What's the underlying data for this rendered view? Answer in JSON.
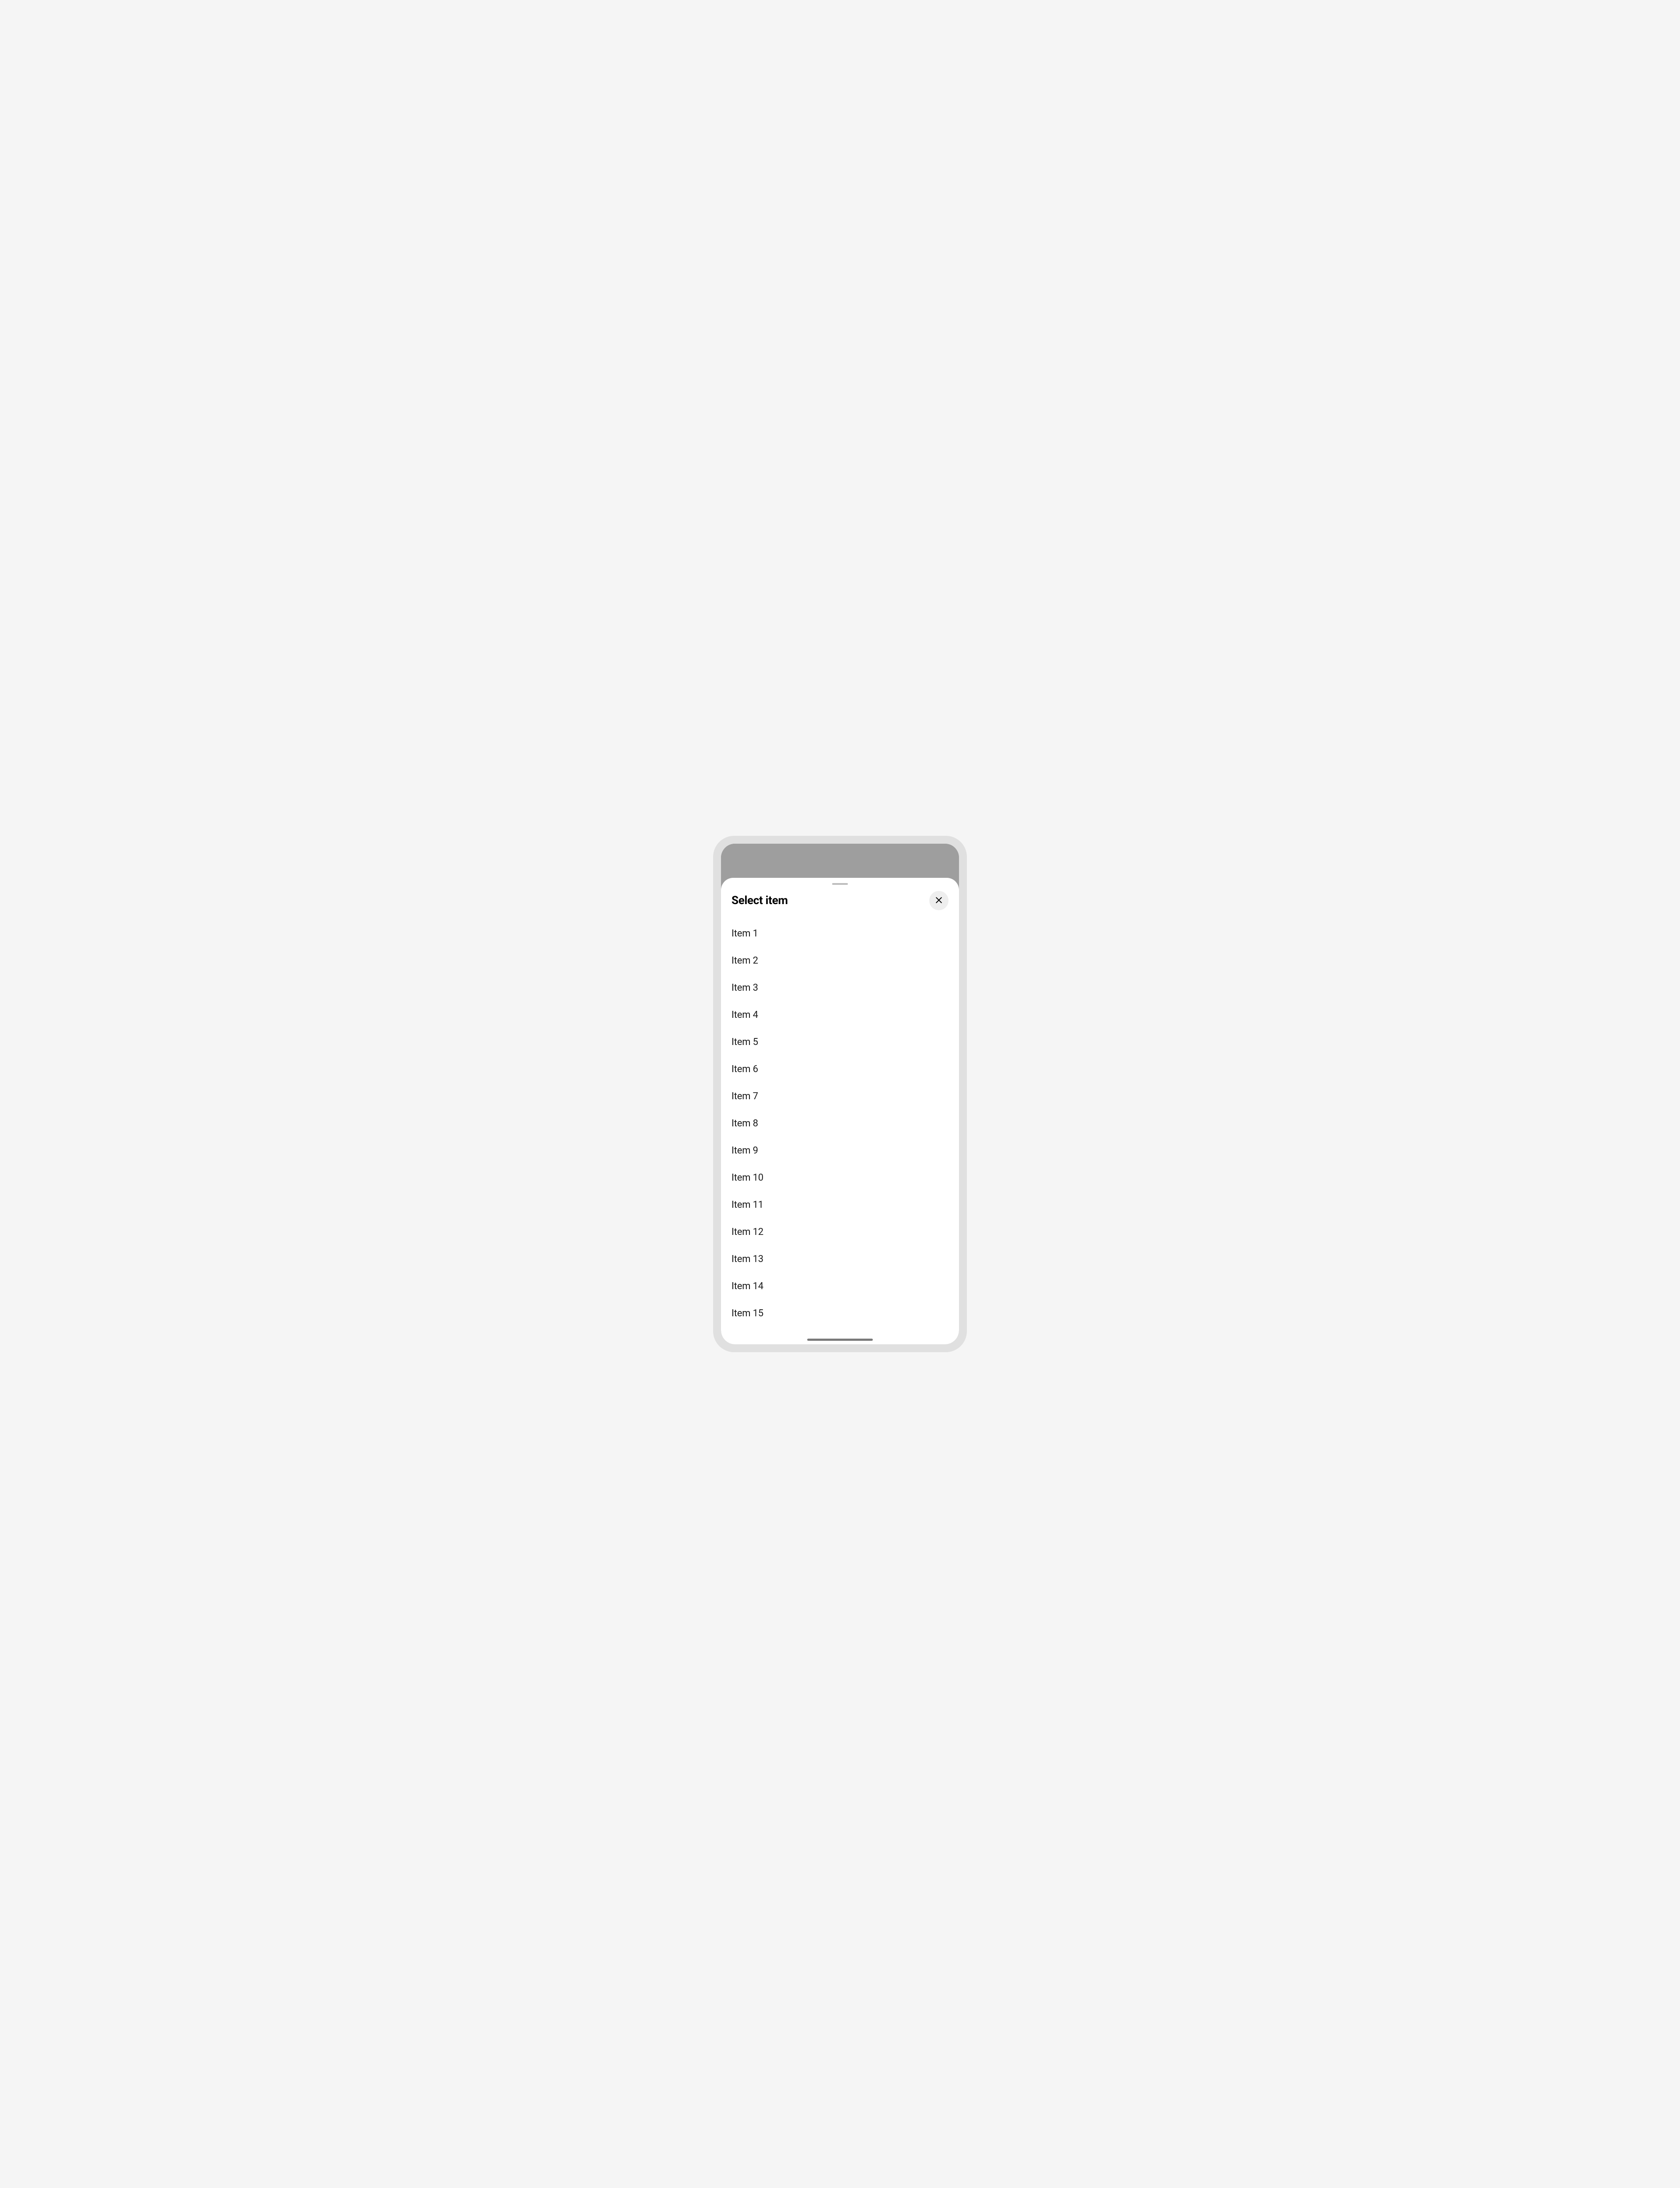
{
  "sheet": {
    "title": "Select item",
    "items": [
      {
        "label": "Item 1"
      },
      {
        "label": "Item 2"
      },
      {
        "label": "Item 3"
      },
      {
        "label": "Item 4"
      },
      {
        "label": "Item 5"
      },
      {
        "label": "Item 6"
      },
      {
        "label": "Item 7"
      },
      {
        "label": "Item 8"
      },
      {
        "label": "Item 9"
      },
      {
        "label": "Item 10"
      },
      {
        "label": "Item 11"
      },
      {
        "label": "Item 12"
      },
      {
        "label": "Item 13"
      },
      {
        "label": "Item 14"
      },
      {
        "label": "Item 15"
      }
    ]
  },
  "icons": {
    "close": "close-icon"
  }
}
